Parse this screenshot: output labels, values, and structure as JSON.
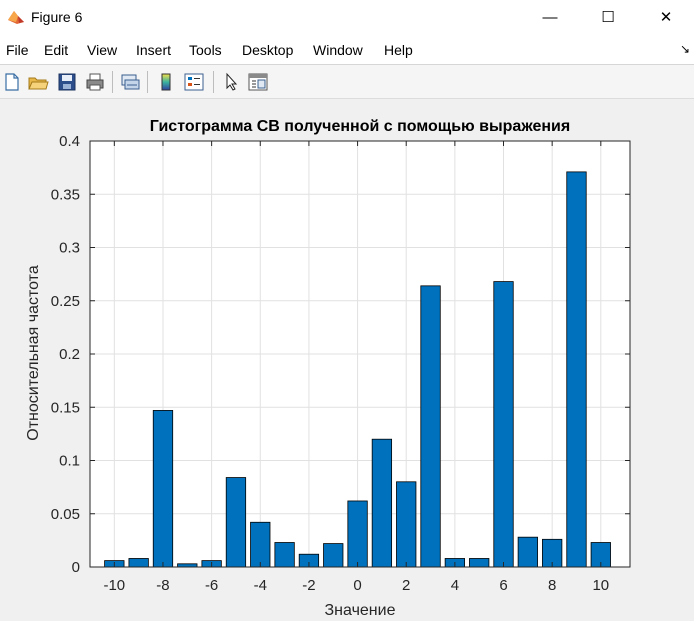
{
  "window": {
    "title": "Figure 6",
    "minimize_glyph": "—",
    "maximize_glyph": "☐",
    "close_glyph": "✕",
    "icon": "matlab-icon"
  },
  "menu": {
    "items": [
      "File",
      "Edit",
      "View",
      "Insert",
      "Tools",
      "Desktop",
      "Window",
      "Help"
    ],
    "dock_glyph": "↘"
  },
  "toolbar": {
    "buttons": [
      "new-figure-icon",
      "open-file-icon",
      "save-icon",
      "print-icon",
      "link-plot-icon",
      "colorbar-icon",
      "legend-icon",
      "pointer-icon",
      "property-editor-icon"
    ]
  },
  "colors": {
    "bar_fill": "#0072bd",
    "bar_edge": "#000000",
    "grid": "#e1e1e1",
    "axes_bg": "#ffffff"
  },
  "chart_data": {
    "type": "bar",
    "title": "Гистограмма СВ полученной с помощью выражения",
    "xlabel": "Значение",
    "ylabel": "Относительная частота",
    "x": [
      -10,
      -9,
      -8,
      -7,
      -6,
      -5,
      -4,
      -3,
      -2,
      -1,
      0,
      1,
      2,
      3,
      4,
      5,
      6,
      7,
      8,
      9,
      10
    ],
    "values": [
      0.006,
      0.008,
      0.147,
      0.003,
      0.006,
      0.084,
      0.042,
      0.023,
      0.012,
      0.022,
      0.062,
      0.12,
      0.08,
      0.264,
      0.008,
      0.008,
      0.268,
      0.028,
      0.026,
      0.371,
      0.023
    ],
    "xlim": [
      -11,
      11.2
    ],
    "ylim": [
      0,
      0.4
    ],
    "xticks": [
      "-10",
      "-8",
      "-6",
      "-4",
      "-2",
      "0",
      "2",
      "4",
      "6",
      "8",
      "10"
    ],
    "yticks": [
      "0",
      "0.05",
      "0.1",
      "0.15",
      "0.2",
      "0.25",
      "0.3",
      "0.35",
      "0.4"
    ],
    "grid": true
  }
}
